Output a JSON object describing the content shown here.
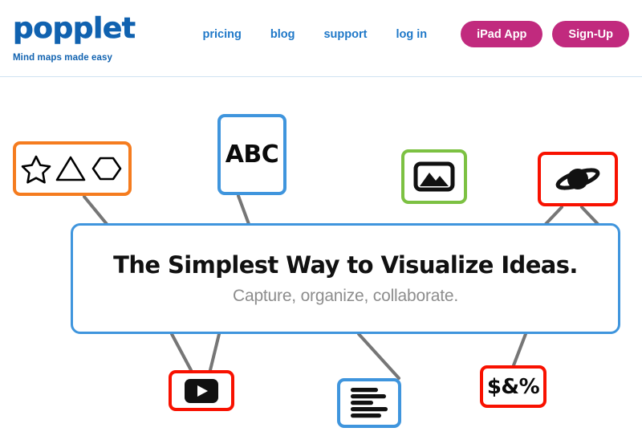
{
  "header": {
    "logo_text": "popplet",
    "tagline": "Mind maps made easy",
    "nav_links": [
      {
        "label": "pricing",
        "name": "nav-pricing"
      },
      {
        "label": "blog",
        "name": "nav-blog"
      },
      {
        "label": "support",
        "name": "nav-support"
      },
      {
        "label": "log in",
        "name": "nav-login"
      }
    ],
    "buttons": [
      {
        "label": "iPad App",
        "name": "ipad-app-button"
      },
      {
        "label": "Sign-Up",
        "name": "sign-up-button"
      }
    ]
  },
  "hero": {
    "title": "The Simplest Way to Visualize Ideas.",
    "subtitle": "Capture, organize, collaborate."
  },
  "nodes": {
    "shapes": {
      "icon": "shapes-icon",
      "border_color": "#f57c1f"
    },
    "abc": {
      "text": "ABC",
      "border_color": "#3f95dd"
    },
    "image": {
      "icon": "image-icon",
      "border_color": "#7cc142"
    },
    "planet": {
      "icon": "planet-icon",
      "border_color": "#f81100"
    },
    "video": {
      "icon": "video-play-icon",
      "border_color": "#f81100"
    },
    "doc": {
      "icon": "text-lines-icon",
      "border_color": "#3f95dd"
    },
    "money": {
      "text": "$&%",
      "border_color": "#f81100"
    }
  },
  "colors": {
    "brand_blue": "#1062b0",
    "link_blue": "#1f78c8",
    "accent_magenta": "#c12a7e",
    "node_blue": "#3f95dd",
    "node_orange": "#f57c1f",
    "node_green": "#7cc142",
    "node_red": "#f81100",
    "wire_gray": "#767676",
    "subtitle_gray": "#8d8d8d"
  }
}
